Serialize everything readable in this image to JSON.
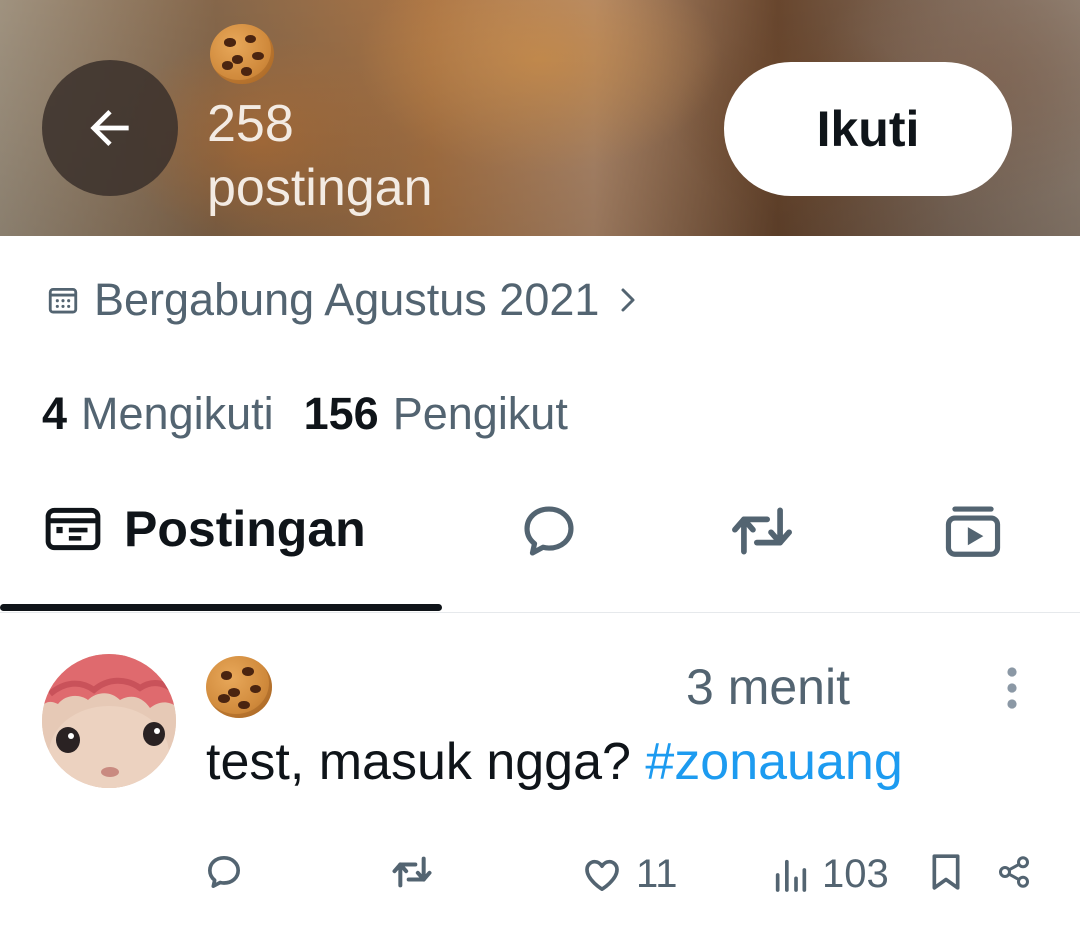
{
  "header": {
    "post_count": "258",
    "post_count_label": "postingan",
    "follow_label": "Ikuti",
    "icons": {
      "back": "arrow-left-icon",
      "name_emoji": "cookie-emoji"
    }
  },
  "profile": {
    "joined": "Bergabung Agustus 2021",
    "following_count": "4",
    "following_label": "Mengikuti",
    "followers_count": "156",
    "followers_label": "Pengikut"
  },
  "tabs": {
    "active_label": "Postingan",
    "items": [
      "posts-icon",
      "reply-bubble-icon",
      "repost-icon",
      "media-icon"
    ]
  },
  "post": {
    "time": "3 menit",
    "text": "test, masuk ngga?",
    "hashtag": "#zonauang",
    "likes": "11",
    "views": "103"
  },
  "colors": {
    "text_primary": "#0f1419",
    "text_secondary": "#536471",
    "link": "#1d9bf0",
    "button_bg": "#ffffff"
  }
}
